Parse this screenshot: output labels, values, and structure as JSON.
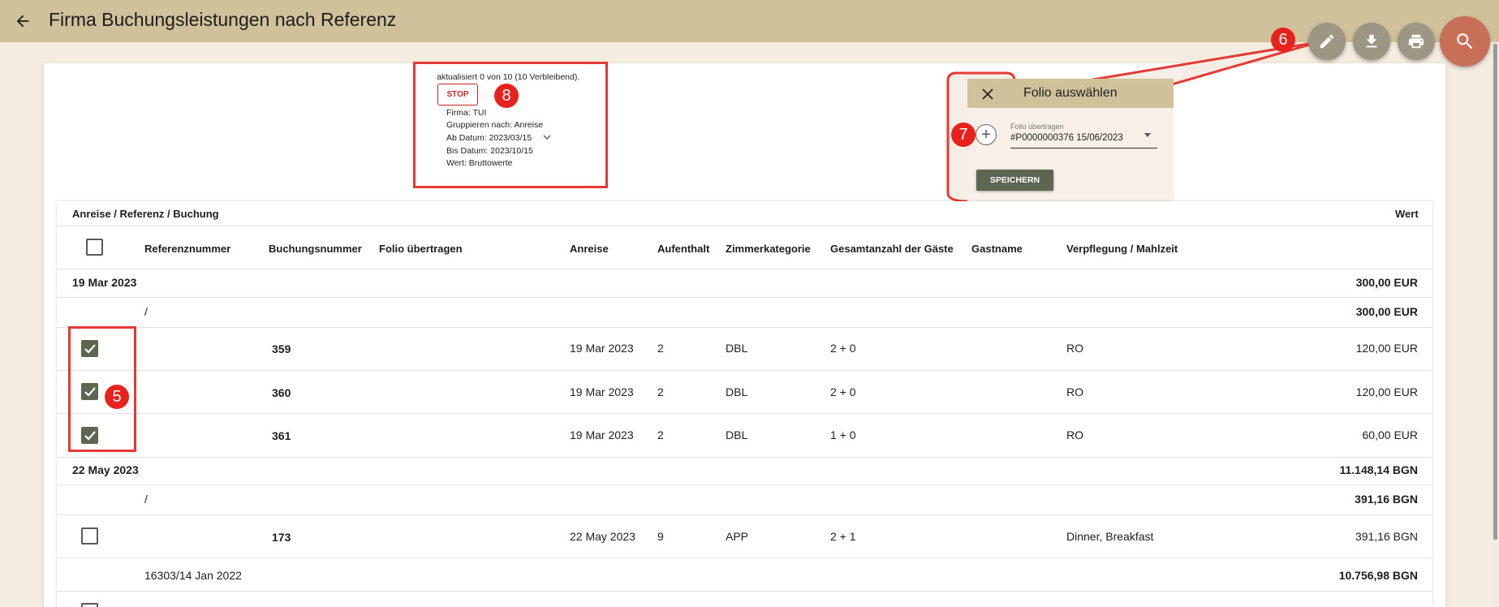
{
  "header": {
    "title": "Firma Buchungsleistungen nach Referenz",
    "back_icon": "arrow-left-icon"
  },
  "toolbar": {
    "edit_icon": "pencil-icon",
    "download_icon": "download-icon",
    "print_icon": "printer-icon",
    "search_icon": "search-icon"
  },
  "annotations": {
    "badge5": "5",
    "badge6": "6",
    "badge7": "7",
    "badge8": "8"
  },
  "progress": {
    "status": "aktualisiert 0 von 10 (10 Verbleibend).",
    "stop_label": "STOP",
    "firma": "Firma: TUI",
    "group": "Gruppieren nach: Anreise",
    "from": "Ab Datum: 2023/03/15",
    "to": "Bis Datum: 2023/10/15",
    "value": "Wert: Bruttowerte"
  },
  "folio_dialog": {
    "title": "Folio auswählen",
    "field_label": "Folio übertragen",
    "field_value": "#P0000000376 15/06/2023",
    "save_label": "SPEICHERN"
  },
  "table": {
    "group_header": "Anreise / Referenz / Buchung",
    "value_header": "Wert",
    "columns": [
      "Referenznummer",
      "Buchungsnummer",
      "Folio übertragen",
      "Anreise",
      "Aufenthalt",
      "Zimmerkategorie",
      "Gesamtanzahl der Gäste",
      "Gastname",
      "Verpflegung / Mahlzeit"
    ],
    "groups": [
      {
        "date": "19 Mar 2023",
        "total": "300,00 EUR",
        "sub_ref": "/",
        "sub_total": "300,00 EUR",
        "rows": [
          {
            "booking": "359",
            "arrival": "19 Mar 2023",
            "stay": "2",
            "room": "DBL",
            "guests": "2 + 0",
            "meal": "RO",
            "value": "120,00 EUR",
            "checked": true
          },
          {
            "booking": "360",
            "arrival": "19 Mar 2023",
            "stay": "2",
            "room": "DBL",
            "guests": "2 + 0",
            "meal": "RO",
            "value": "120,00 EUR",
            "checked": true
          },
          {
            "booking": "361",
            "arrival": "19 Mar 2023",
            "stay": "2",
            "room": "DBL",
            "guests": "1 + 0",
            "meal": "RO",
            "value": "60,00 EUR",
            "checked": true
          }
        ]
      },
      {
        "date": "22 May 2023",
        "total": "11.148,14 BGN",
        "sub_ref": "/",
        "sub_total": "391,16 BGN",
        "rows": [
          {
            "booking": "173",
            "arrival": "22 May 2023",
            "stay": "9",
            "room": "APP",
            "guests": "2 + 1",
            "meal": "Dinner, Breakfast",
            "value": "391,16 BGN",
            "checked": false
          }
        ],
        "sub2_ref": "16303/14 Jan 2022",
        "sub2_total": "10.756,98 BGN"
      }
    ]
  },
  "colors": {
    "header_bg": "#d1c19b",
    "page_bg": "#f5ece0",
    "accent_green": "#5c6650",
    "search_fab": "#c86f57",
    "annotation_red": "#e53935"
  }
}
